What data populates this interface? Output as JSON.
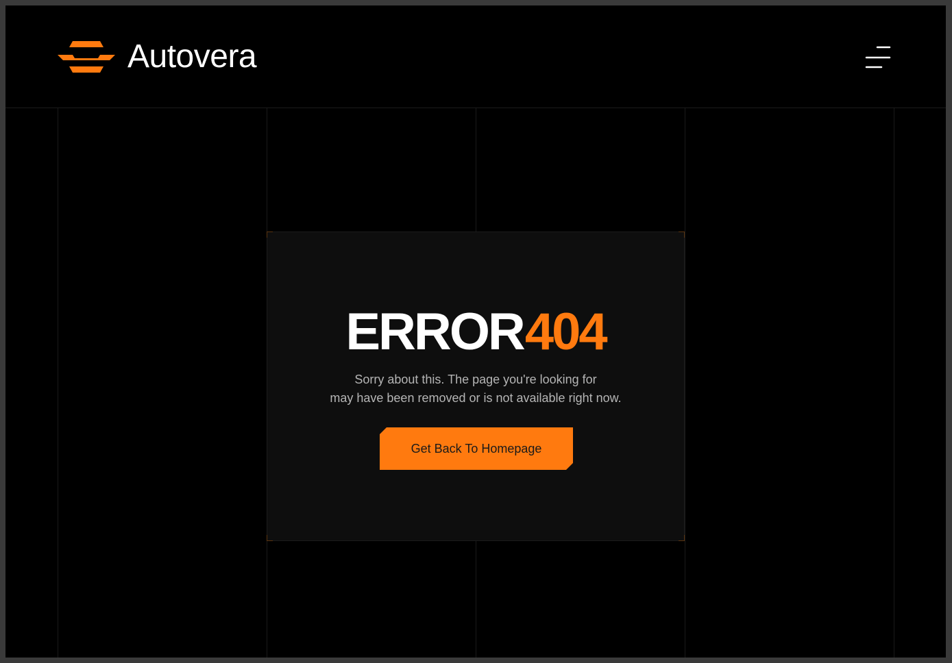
{
  "header": {
    "logo_icon": "autovera-logo-mark",
    "brand_name": "Autovera",
    "menu_icon": "hamburger-menu-icon"
  },
  "error": {
    "word": "ERROR",
    "code": "404",
    "message_line1": "Sorry about this. The page you're looking for",
    "message_line2": "may have been removed or is not available right now.",
    "button_label": "Get Back To Homepage"
  },
  "colors": {
    "background": "#000000",
    "card": "#0e0e0e",
    "accent": "#ff7a0f",
    "text_primary": "#ffffff",
    "text_secondary": "#b5b5b5"
  }
}
